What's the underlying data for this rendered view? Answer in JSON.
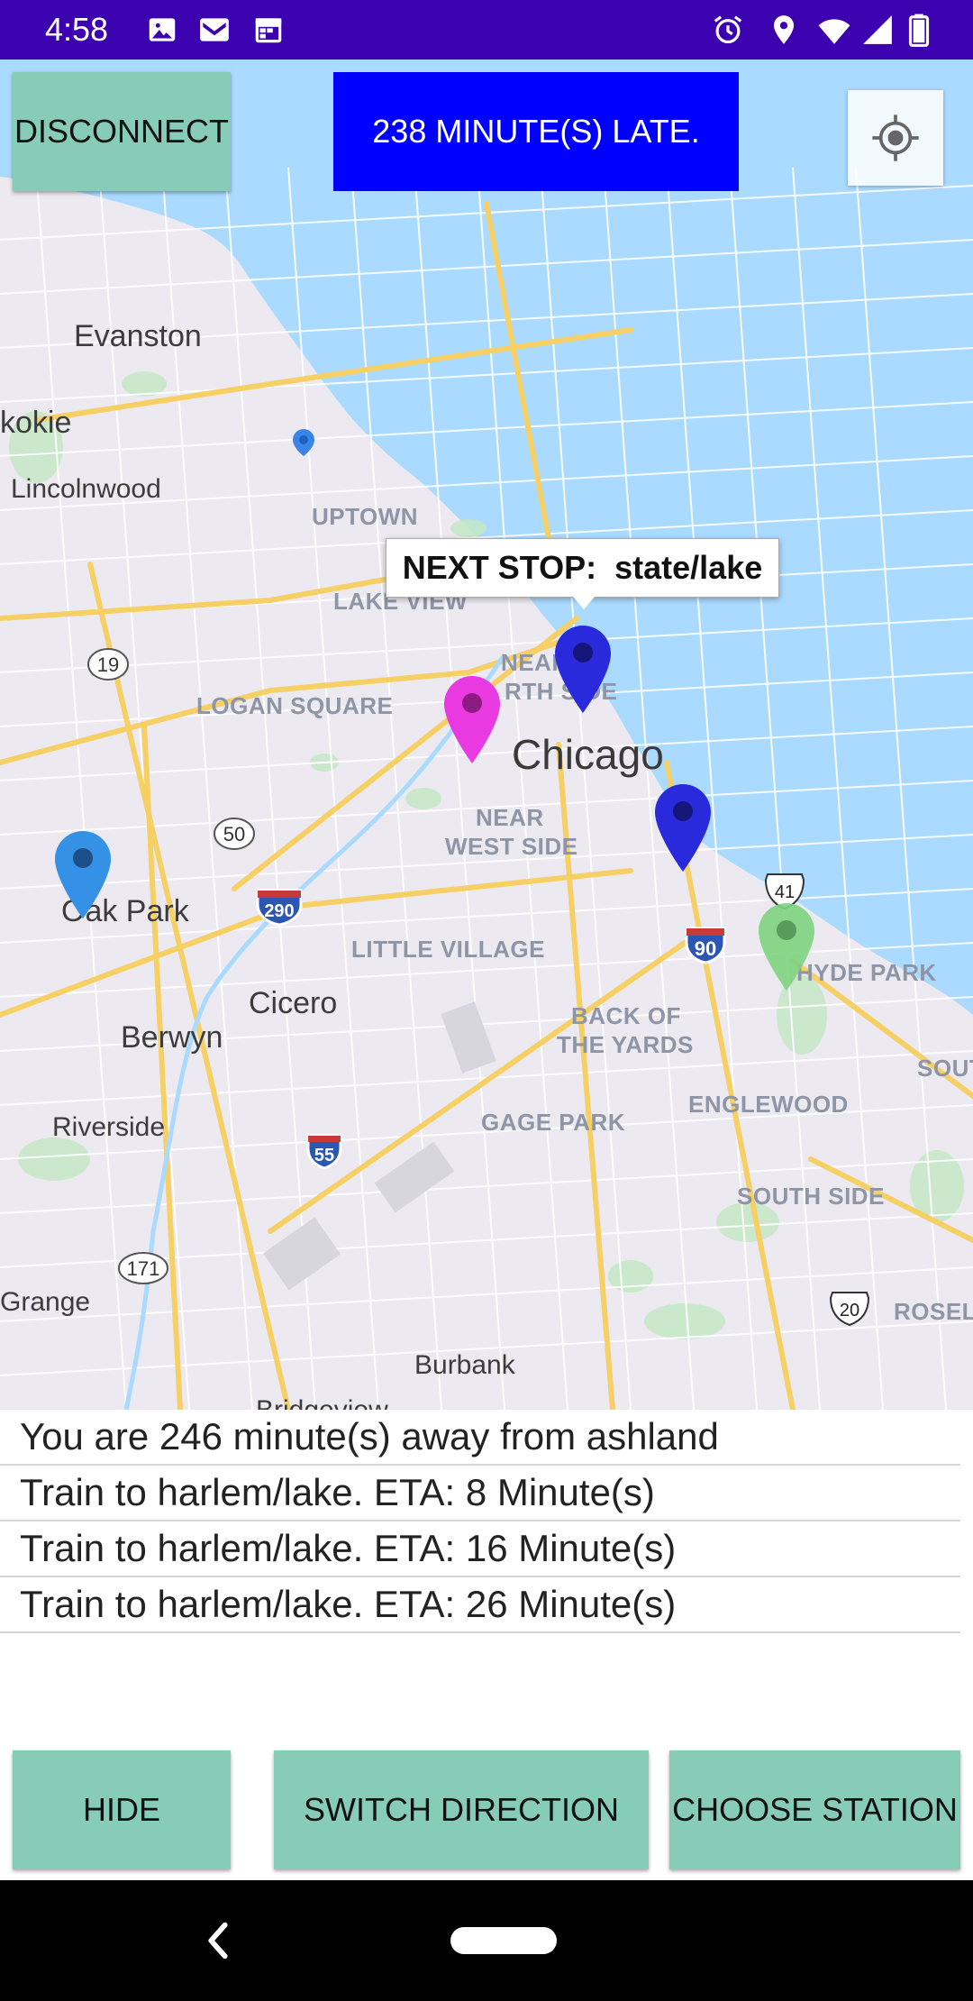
{
  "status_bar": {
    "time": "4:58",
    "left_icons": [
      "image-icon",
      "gmail-icon",
      "calendar-icon"
    ],
    "right_icons": [
      "alarm-icon",
      "location-icon",
      "wifi-icon",
      "signal-icon",
      "battery-icon"
    ]
  },
  "top_bar": {
    "disconnect_label": "DISCONNECT",
    "late_label": "238 MINUTE(S) LATE.",
    "late_color": "#0000ff",
    "button_color": "#86ccb6"
  },
  "map": {
    "labels": {
      "evanston": "Evanston",
      "skokie": "kokie",
      "lincolnwood": "Lincolnwood",
      "uptown": "UPTOWN",
      "lake_view": "LAKE VIEW",
      "near_north_1": "NEAR",
      "near_north_2": "RTH SIDE",
      "logan_square": "LOGAN SQUARE",
      "chicago": "Chicago",
      "near_west_1": "NEAR",
      "near_west_2": "WEST SIDE",
      "oak_park": "Oak Park",
      "little_village": "LITTLE VILLAGE",
      "cicero": "Cicero",
      "berwyn": "Berwyn",
      "back_of_yards_1": "BACK OF",
      "back_of_yards_2": "THE YARDS",
      "hyde_park": "HYDE PARK",
      "south_shore": "SOUT",
      "riverside": "Riverside",
      "gage_park": "GAGE PARK",
      "englewood": "ENGLEWOOD",
      "south_side": "SOUTH SIDE",
      "grange": "Grange",
      "burbank": "Burbank",
      "roseland": "ROSELA",
      "bridgeview": "Bridgeview"
    },
    "shields": {
      "r19": "19",
      "r50": "50",
      "i290": "290",
      "i90": "90",
      "r41": "41",
      "i55": "55",
      "r171": "171",
      "r20": "20"
    },
    "callout": "NEXT STOP:  state/lake",
    "pin_colors": {
      "next_stop": "#2a2add",
      "magenta": "#e83ae0",
      "south": "#2a2add",
      "green": "#7ed37e",
      "oak_park": "#3491e6"
    },
    "water_color": "#aadaff"
  },
  "list": {
    "rows": [
      "You are 246 minute(s) away from ashland",
      "Train to harlem/lake. ETA: 8 Minute(s)",
      "Train to harlem/lake. ETA: 16 Minute(s)",
      "Train to harlem/lake. ETA: 26 Minute(s)"
    ]
  },
  "bottom_bar": {
    "hide_label": "HIDE",
    "switch_label": "SWITCH DIRECTION",
    "choose_label": "CHOOSE STATION"
  }
}
